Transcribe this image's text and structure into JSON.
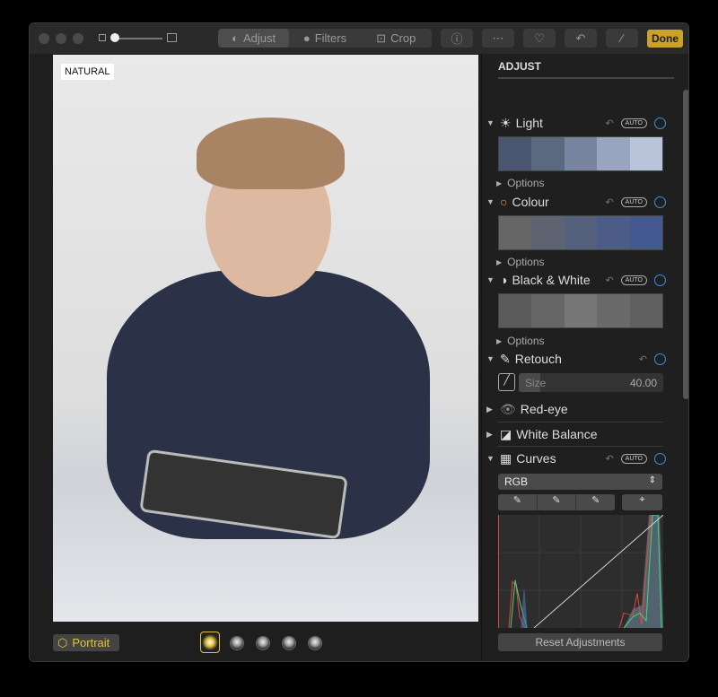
{
  "toolbar": {
    "tabs": [
      {
        "label": "Adjust",
        "icon": "adjust-icon"
      },
      {
        "label": "Filters",
        "icon": "filters-icon"
      },
      {
        "label": "Crop",
        "icon": "crop-icon"
      }
    ],
    "done_label": "Done",
    "accent": "#c9a227"
  },
  "photo": {
    "badge": "NATURAL"
  },
  "sidebar": {
    "title": "ADJUST",
    "auto_label": "AUTO",
    "options_label": "Options",
    "sections": {
      "light": "Light",
      "colour": "Colour",
      "bw": "Black & White",
      "retouch": "Retouch",
      "redeye": "Red-eye",
      "wb": "White Balance",
      "curves": "Curves"
    },
    "retouch": {
      "size_label": "Size",
      "size_value": "40.00",
      "size_fraction": 0.15
    },
    "curves": {
      "channel": "RGB"
    },
    "reset_label": "Reset Adjustments"
  },
  "bottom": {
    "portrait_label": "Portrait"
  }
}
